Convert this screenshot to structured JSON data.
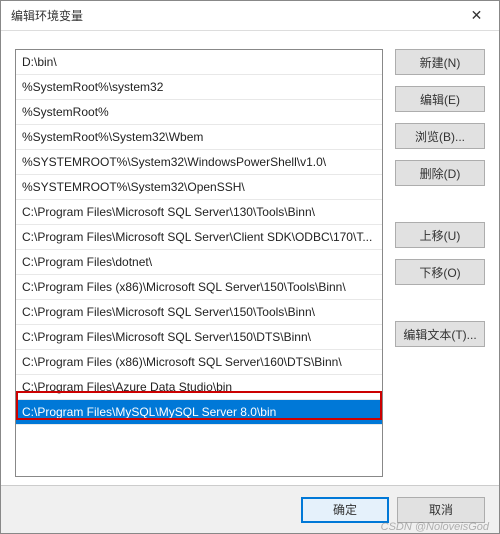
{
  "title": "编辑环境变量",
  "close_glyph": "✕",
  "list_items": [
    "D:\\bin\\",
    "%SystemRoot%\\system32",
    "%SystemRoot%",
    "%SystemRoot%\\System32\\Wbem",
    "%SYSTEMROOT%\\System32\\WindowsPowerShell\\v1.0\\",
    "%SYSTEMROOT%\\System32\\OpenSSH\\",
    "C:\\Program Files\\Microsoft SQL Server\\130\\Tools\\Binn\\",
    "C:\\Program Files\\Microsoft SQL Server\\Client SDK\\ODBC\\170\\T...",
    "C:\\Program Files\\dotnet\\",
    "C:\\Program Files (x86)\\Microsoft SQL Server\\150\\Tools\\Binn\\",
    "C:\\Program Files\\Microsoft SQL Server\\150\\Tools\\Binn\\",
    "C:\\Program Files\\Microsoft SQL Server\\150\\DTS\\Binn\\",
    "C:\\Program Files (x86)\\Microsoft SQL Server\\160\\DTS\\Binn\\",
    "C:\\Program Files\\Azure Data Studio\\bin",
    "C:\\Program Files\\MySQL\\MySQL Server 8.0\\bin"
  ],
  "selected_index": 14,
  "highlight_index": 14,
  "buttons": {
    "new": "新建(N)",
    "edit": "编辑(E)",
    "browse": "浏览(B)...",
    "delete": "删除(D)",
    "moveup": "上移(U)",
    "movedown": "下移(O)",
    "edittext": "编辑文本(T)...",
    "ok": "确定",
    "cancel": "取消"
  },
  "watermark": "CSDN @NoloveisGod"
}
